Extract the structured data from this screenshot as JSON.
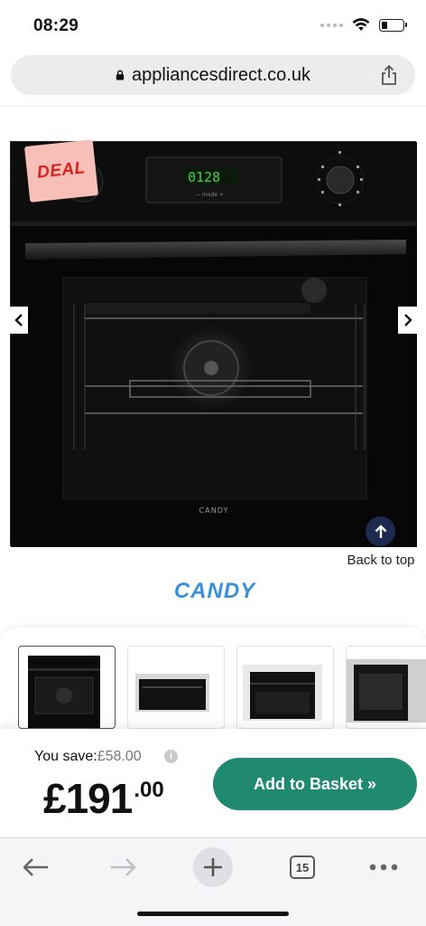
{
  "status_bar": {
    "time": "08:29",
    "battery_level": 0.3
  },
  "browser": {
    "url": "appliancesdirect.co.uk",
    "tab_count": "15"
  },
  "product": {
    "deal_badge": "DEAL",
    "display_time": "0128",
    "brand_on_oven": "CANDY",
    "brand_logo": "CANDY",
    "back_to_top": "Back to top"
  },
  "thumbnails": [
    {
      "label": "Oven front view",
      "active": true
    },
    {
      "label": "Oven installed view",
      "active": false
    },
    {
      "label": "Oven kitchen view",
      "active": false
    },
    {
      "label": "Oven side view",
      "active": false
    }
  ],
  "pricing": {
    "you_save_label": "You save:",
    "you_save_amount": "£58.00",
    "price_main": "£191",
    "price_pence": ".00",
    "add_to_basket": "Add to Basket »"
  },
  "colors": {
    "accent_green": "#1f8a70",
    "deal_red": "#d9211d",
    "deal_bg": "#f8bfb8",
    "candy_blue": "#3b8fd8",
    "back_top_bg": "#1d2a4f"
  }
}
